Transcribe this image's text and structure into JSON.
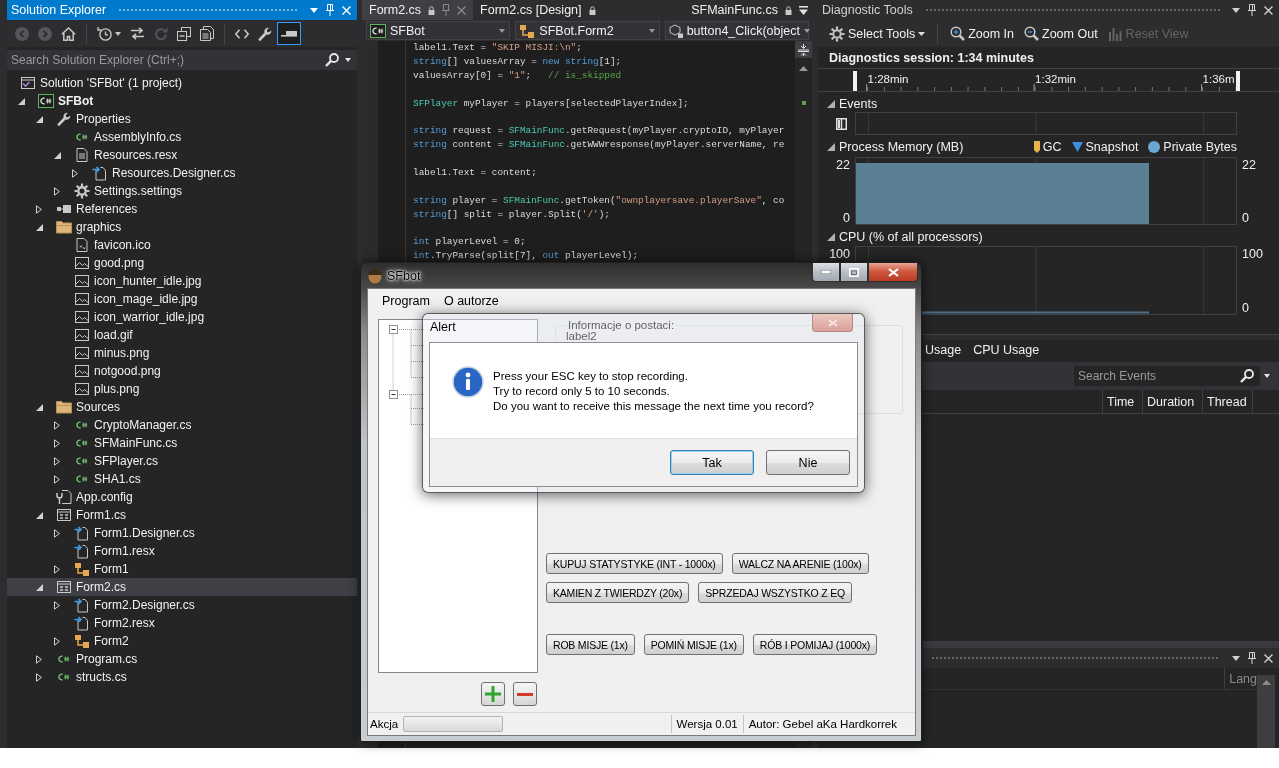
{
  "solution_explorer": {
    "title": "Solution Explorer",
    "focused": true,
    "toolbar_groups": [
      {
        "buttons": [
          {
            "kind": "back",
            "disabled": true,
            "on": false
          },
          {
            "kind": "forward",
            "disabled": true,
            "on": false
          },
          {
            "kind": "home",
            "disabled": false,
            "on": false
          }
        ]
      },
      {
        "buttons": [
          {
            "kind": "history",
            "disabled": false,
            "on": false
          },
          {
            "kind": "sync",
            "disabled": false,
            "on": false
          },
          {
            "kind": "refresh",
            "disabled": true,
            "on": false
          },
          {
            "kind": "collapse",
            "disabled": false,
            "on": false
          },
          {
            "kind": "copy",
            "disabled": false,
            "on": false
          }
        ]
      },
      {
        "buttons": [
          {
            "kind": "code",
            "disabled": false,
            "on": false
          },
          {
            "kind": "wrench",
            "disabled": false,
            "on": false
          },
          {
            "kind": "preview",
            "disabled": false,
            "on": true
          }
        ]
      }
    ],
    "search": {
      "placeholder": "Search Solution Explorer (Ctrl+;)"
    },
    "tree": [
      {
        "label": "Solution 'SFBot' (1 project)",
        "kind": "solution",
        "selected": false,
        "children": [
          {
            "label": "SFBot",
            "kind": "project",
            "expanded": true,
            "selected": false,
            "children": [
              {
                "label": "Properties",
                "kind": "wrench",
                "expanded": true,
                "selected": false,
                "children": [
                  {
                    "label": "AssemblyInfo.cs",
                    "kind": "cs",
                    "selected": false
                  },
                  {
                    "label": "Resources.resx",
                    "kind": "resx",
                    "expanded": true,
                    "selected": false,
                    "children": [
                      {
                        "label": "Resources.Designer.cs",
                        "kind": "linked",
                        "expanded": false,
                        "selected": false
                      }
                    ]
                  },
                  {
                    "label": "Settings.settings",
                    "kind": "settings",
                    "expanded": false,
                    "selected": false
                  }
                ]
              },
              {
                "label": "References",
                "kind": "references",
                "expanded": false,
                "selected": false
              },
              {
                "label": "graphics",
                "kind": "folder",
                "expanded": true,
                "selected": false,
                "children": [
                  {
                    "label": "favicon.ico",
                    "kind": "ico",
                    "selected": false
                  },
                  {
                    "label": "good.png",
                    "kind": "image",
                    "selected": false
                  },
                  {
                    "label": "icon_hunter_idle.jpg",
                    "kind": "image",
                    "selected": false
                  },
                  {
                    "label": "icon_mage_idle.jpg",
                    "kind": "image",
                    "selected": false
                  },
                  {
                    "label": "icon_warrior_idle.jpg",
                    "kind": "image",
                    "selected": false
                  },
                  {
                    "label": "load.gif",
                    "kind": "image",
                    "selected": false
                  },
                  {
                    "label": "minus.png",
                    "kind": "image",
                    "selected": false
                  },
                  {
                    "label": "notgood.png",
                    "kind": "image",
                    "selected": false
                  },
                  {
                    "label": "plus.png",
                    "kind": "image",
                    "selected": false
                  }
                ]
              },
              {
                "label": "Sources",
                "kind": "folder",
                "expanded": true,
                "selected": false,
                "children": [
                  {
                    "label": "CryptoManager.cs",
                    "kind": "cs",
                    "expanded": false,
                    "selected": false
                  },
                  {
                    "label": "SFMainFunc.cs",
                    "kind": "cs",
                    "expanded": false,
                    "selected": false
                  },
                  {
                    "label": "SFPlayer.cs",
                    "kind": "cs",
                    "expanded": false,
                    "selected": false
                  },
                  {
                    "label": "SHA1.cs",
                    "kind": "cs",
                    "expanded": false,
                    "selected": false
                  }
                ]
              },
              {
                "label": "App.config",
                "kind": "config",
                "selected": false
              },
              {
                "label": "Form1.cs",
                "kind": "form",
                "expanded": true,
                "selected": false,
                "children": [
                  {
                    "label": "Form1.Designer.cs",
                    "kind": "linked",
                    "expanded": false,
                    "selected": false
                  },
                  {
                    "label": "Form1.resx",
                    "kind": "linked",
                    "selected": false
                  },
                  {
                    "label": "Form1",
                    "kind": "class",
                    "expanded": false,
                    "selected": false
                  }
                ]
              },
              {
                "label": "Form2.cs",
                "kind": "form",
                "expanded": true,
                "selected": true,
                "children": [
                  {
                    "label": "Form2.Designer.cs",
                    "kind": "linked",
                    "expanded": false,
                    "selected": false
                  },
                  {
                    "label": "Form2.resx",
                    "kind": "linked",
                    "selected": false
                  },
                  {
                    "label": "Form2",
                    "kind": "class",
                    "expanded": false,
                    "selected": false
                  }
                ]
              },
              {
                "label": "Program.cs",
                "kind": "cs",
                "expanded": false,
                "selected": false
              },
              {
                "label": "structs.cs",
                "kind": "cs",
                "expanded": false,
                "selected": false
              }
            ]
          }
        ]
      }
    ]
  },
  "editor": {
    "tabs": [
      {
        "label": "Form2.cs",
        "selected": true,
        "preview": false,
        "locked": true
      },
      {
        "label": "Form2.cs [Design]",
        "selected": false,
        "preview": false,
        "locked": true
      },
      {
        "label": "SFMainFunc.cs",
        "selected": false,
        "preview": true,
        "locked": true
      }
    ],
    "navigation": [
      {
        "kind": "project",
        "label": "SFBot"
      },
      {
        "kind": "class",
        "label": "SFBot.Form2"
      },
      {
        "kind": "method",
        "label": "button4_Click(object"
      }
    ],
    "code_lines": [
      {
        "kind": "code",
        "tokens": [
          {
            "kind": "plain",
            "text": "label1.Text = "
          },
          {
            "kind": "string",
            "text": "\"SKIP MISJI:\\n\""
          },
          {
            "kind": "plain",
            "text": ";"
          }
        ]
      },
      {
        "kind": "code",
        "tokens": [
          {
            "kind": "keyword",
            "text": "string"
          },
          {
            "kind": "plain",
            "text": "[] valuesArray = "
          },
          {
            "kind": "keyword",
            "text": "new string"
          },
          {
            "kind": "plain",
            "text": "[1];"
          }
        ]
      },
      {
        "kind": "code",
        "tokens": [
          {
            "kind": "plain",
            "text": "valuesArray[0] = "
          },
          {
            "kind": "string",
            "text": "\"1\""
          },
          {
            "kind": "plain",
            "text": ";   "
          },
          {
            "kind": "comment",
            "text": "// is_skipped"
          }
        ]
      },
      {
        "kind": "blank"
      },
      {
        "kind": "code",
        "tokens": [
          {
            "kind": "type",
            "text": "SFPlayer"
          },
          {
            "kind": "plain",
            "text": " myPlayer = players[selectedPlayerIndex];"
          }
        ]
      },
      {
        "kind": "blank"
      },
      {
        "kind": "code",
        "tokens": [
          {
            "kind": "keyword",
            "text": "string"
          },
          {
            "kind": "plain",
            "text": " request = "
          },
          {
            "kind": "type",
            "text": "SFMainFunc"
          },
          {
            "kind": "plain",
            "text": ".getRequest(myPlayer.cryptoID, myPlayer"
          }
        ]
      },
      {
        "kind": "code",
        "tokens": [
          {
            "kind": "keyword",
            "text": "string"
          },
          {
            "kind": "plain",
            "text": " content = "
          },
          {
            "kind": "type",
            "text": "SFMainFunc"
          },
          {
            "kind": "plain",
            "text": ".getWWWresponse(myPlayer.serverName, re"
          }
        ]
      },
      {
        "kind": "blank"
      },
      {
        "kind": "code",
        "tokens": [
          {
            "kind": "plain",
            "text": "label1.Text = content;"
          }
        ]
      },
      {
        "kind": "blank"
      },
      {
        "kind": "code",
        "tokens": [
          {
            "kind": "keyword",
            "text": "string"
          },
          {
            "kind": "plain",
            "text": " player = "
          },
          {
            "kind": "type",
            "text": "SFMainFunc"
          },
          {
            "kind": "plain",
            "text": ".getToken("
          },
          {
            "kind": "string",
            "text": "\"ownplayersave.playerSave\""
          },
          {
            "kind": "plain",
            "text": ", co"
          }
        ]
      },
      {
        "kind": "code",
        "tokens": [
          {
            "kind": "keyword",
            "text": "string"
          },
          {
            "kind": "plain",
            "text": "[] split = player.Split("
          },
          {
            "kind": "string",
            "text": "'/'"
          },
          {
            "kind": "plain",
            "text": ");"
          }
        ]
      },
      {
        "kind": "blank"
      },
      {
        "kind": "code",
        "tokens": [
          {
            "kind": "keyword",
            "text": "int"
          },
          {
            "kind": "plain",
            "text": " playerLevel = 0;"
          }
        ]
      },
      {
        "kind": "code",
        "tokens": [
          {
            "kind": "keyword",
            "text": "int"
          },
          {
            "kind": "plain",
            "text": ".TryParse(split[7], "
          },
          {
            "kind": "keyword",
            "text": "out"
          },
          {
            "kind": "plain",
            "text": " playerLevel);"
          }
        ]
      }
    ]
  },
  "diagnostic_tools": {
    "title": "Diagnostic Tools",
    "focused": false,
    "toolbar_groups": [
      {
        "buttons": [
          {
            "kind": "select-tools",
            "label": "Select Tools",
            "disabled": false
          }
        ]
      },
      {
        "buttons": [
          {
            "kind": "zoom-in",
            "label": "Zoom In",
            "disabled": false
          },
          {
            "kind": "zoom-out",
            "label": "Zoom Out",
            "disabled": false
          },
          {
            "kind": "reset-view",
            "label": "Reset View",
            "disabled": true
          }
        ]
      }
    ],
    "session": "Diagnostics session: 1:34 minutes",
    "timeline": {
      "labels": [
        "1:28min",
        "1:32min",
        "1:36m"
      ]
    },
    "events": {
      "title": "Events",
      "expanded": true
    },
    "memory": {
      "title": "Process Memory (MB)",
      "expanded": true,
      "legend": [
        {
          "kind": "gc",
          "label": "GC",
          "color": "#e8b547"
        },
        {
          "kind": "snapshot",
          "label": "Snapshot",
          "color": "#3d8fdc"
        },
        {
          "kind": "series",
          "label": "Private Bytes",
          "color": "#6aa6d2"
        }
      ],
      "left_axis": [
        "22",
        "0"
      ],
      "right_axis": [
        "22",
        "0"
      ]
    },
    "cpu": {
      "title": "CPU (% of all processors)",
      "expanded": true,
      "left_axis": [
        "100"
      ],
      "right_axis": [
        "100",
        "0"
      ]
    },
    "details_tabs": [
      {
        "label": "Usage",
        "selected": false
      },
      {
        "label": "CPU Usage",
        "selected": false
      }
    ],
    "details_search": {
      "placeholder": "Search Events"
    },
    "columns": [
      "Time",
      "Duration",
      "Thread"
    ]
  },
  "bottom_panel": {
    "focused": false,
    "columns": [
      "Lang"
    ]
  },
  "app_window": {
    "title": "SFbot",
    "menu": [
      "Program",
      "O autorze"
    ],
    "group_box": {
      "title": "Informacje o postaci:",
      "text": "label2"
    },
    "button_rows": [
      [
        "KUPUJ STATYSTYKE (INT - 1000x)",
        "WALCZ NA ARENIE (100x)"
      ],
      [
        "KAMIEN Z TWIERDZY (20x)",
        "SPRZEDAJ WSZYSTKO Z EQ"
      ],
      [
        "ROB MISJE (1x)",
        "POMIŃ MISJE (1x)",
        "RÓB I POMIJAJ (1000x)"
      ]
    ],
    "status_bar": {
      "label": "Akcja",
      "progress": {
        "level": 0
      },
      "version": "Wersja 0.01",
      "author": "Autor: Gebel aKa Hardkorrek"
    }
  },
  "alert": {
    "title": "Alert",
    "message_lines": [
      "Press your ESC key to stop recording.",
      "Try to record only 5 to 10 seconds.",
      "Do you want to receive this message the next time you record?"
    ],
    "buttons": [
      {
        "label": "Tak",
        "default": true
      },
      {
        "label": "Nie",
        "default": false
      }
    ]
  }
}
